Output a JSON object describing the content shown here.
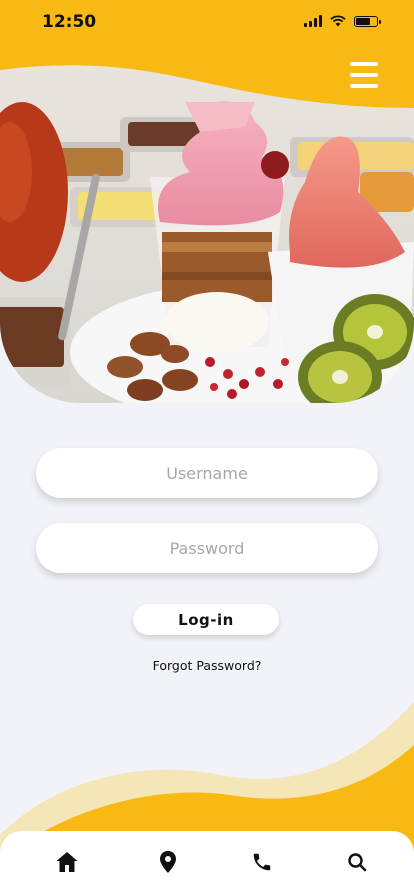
{
  "status_bar": {
    "time": "12:50"
  },
  "login_form": {
    "username_placeholder": "Username",
    "password_placeholder": "Password",
    "login_label": "Log-in",
    "forgot_password": "Forgot Password?"
  },
  "nav": {
    "items": [
      "home-icon",
      "location-pin-icon",
      "phone-icon",
      "search-icon"
    ]
  },
  "colors": {
    "accent": "#f7b912",
    "cream": "#f5e6b8",
    "background": "#f2f3f9"
  }
}
